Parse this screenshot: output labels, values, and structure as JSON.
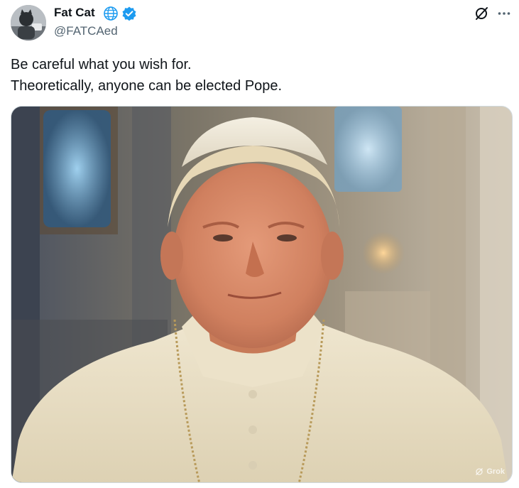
{
  "author": {
    "display_name": "Fat Cat",
    "handle": "@FATCAed",
    "avatar_icon": "cat-avatar-icon",
    "badges": [
      "globe-icon",
      "verified-badge-icon"
    ],
    "verified_color": "#1d9bf0"
  },
  "header_actions": {
    "grok_icon": "grok-slash-icon",
    "more_icon": "more-horizontal-icon",
    "more_label": "···"
  },
  "tweet": {
    "text_line1": "Be careful what you wish for.",
    "text_line2": "Theoretically, anyone can be elected Pope."
  },
  "media": {
    "description_icon": "photo-pope-portrait",
    "watermark": "Grok",
    "watermark_icon": "grok-icon"
  }
}
